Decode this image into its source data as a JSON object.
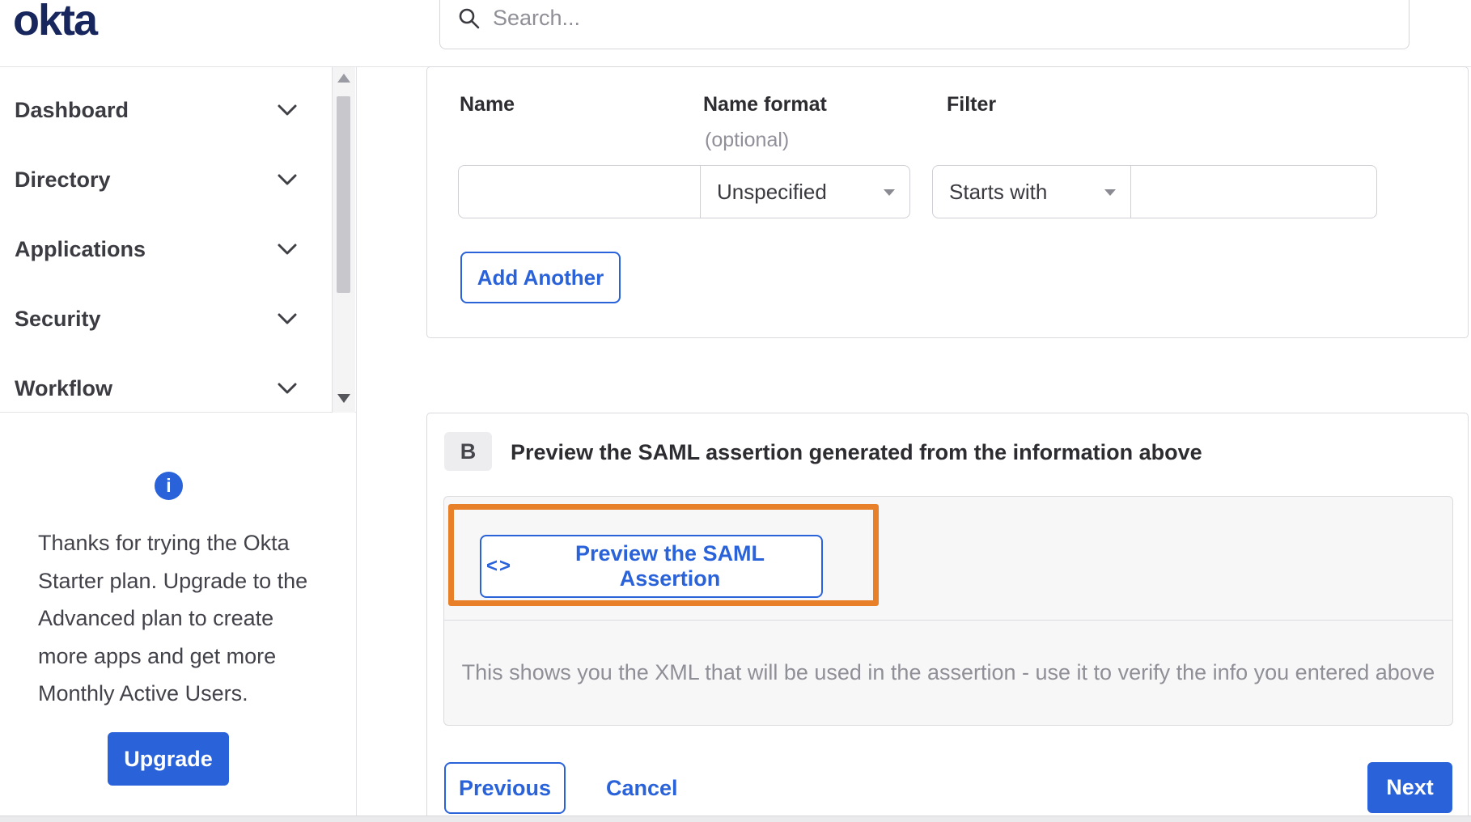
{
  "brand": {
    "logo_text": "okta"
  },
  "header": {
    "search_placeholder": "Search..."
  },
  "sidebar": {
    "items": [
      {
        "label": "Dashboard"
      },
      {
        "label": "Directory"
      },
      {
        "label": "Applications"
      },
      {
        "label": "Security"
      },
      {
        "label": "Workflow"
      }
    ],
    "promo": {
      "info_glyph": "i",
      "text": "Thanks for trying the Okta Starter plan. Upgrade to the Advanced plan to create more apps and get more Monthly Active Users.",
      "upgrade_label": "Upgrade"
    }
  },
  "attribute_statements": {
    "headers": {
      "name": "Name",
      "name_format": "Name format",
      "name_format_note": "(optional)",
      "filter": "Filter"
    },
    "row": {
      "name_value": "",
      "name_format_selected": "Unspecified",
      "filter_type_selected": "Starts with",
      "filter_value": ""
    },
    "add_another_label": "Add Another"
  },
  "preview_section": {
    "badge": "B",
    "title": "Preview the SAML assertion generated from the information above",
    "button_icon": "<>",
    "button_label": "Preview the SAML Assertion",
    "description": "This shows you the XML that will be used in the assertion - use it to verify the info you entered above"
  },
  "footer": {
    "previous_label": "Previous",
    "cancel_label": "Cancel",
    "next_label": "Next"
  },
  "colors": {
    "accent_blue": "#2962D9",
    "logo_navy": "#17265C",
    "highlight_orange": "#E8802A",
    "panel_gray": "#f7f7f8"
  }
}
